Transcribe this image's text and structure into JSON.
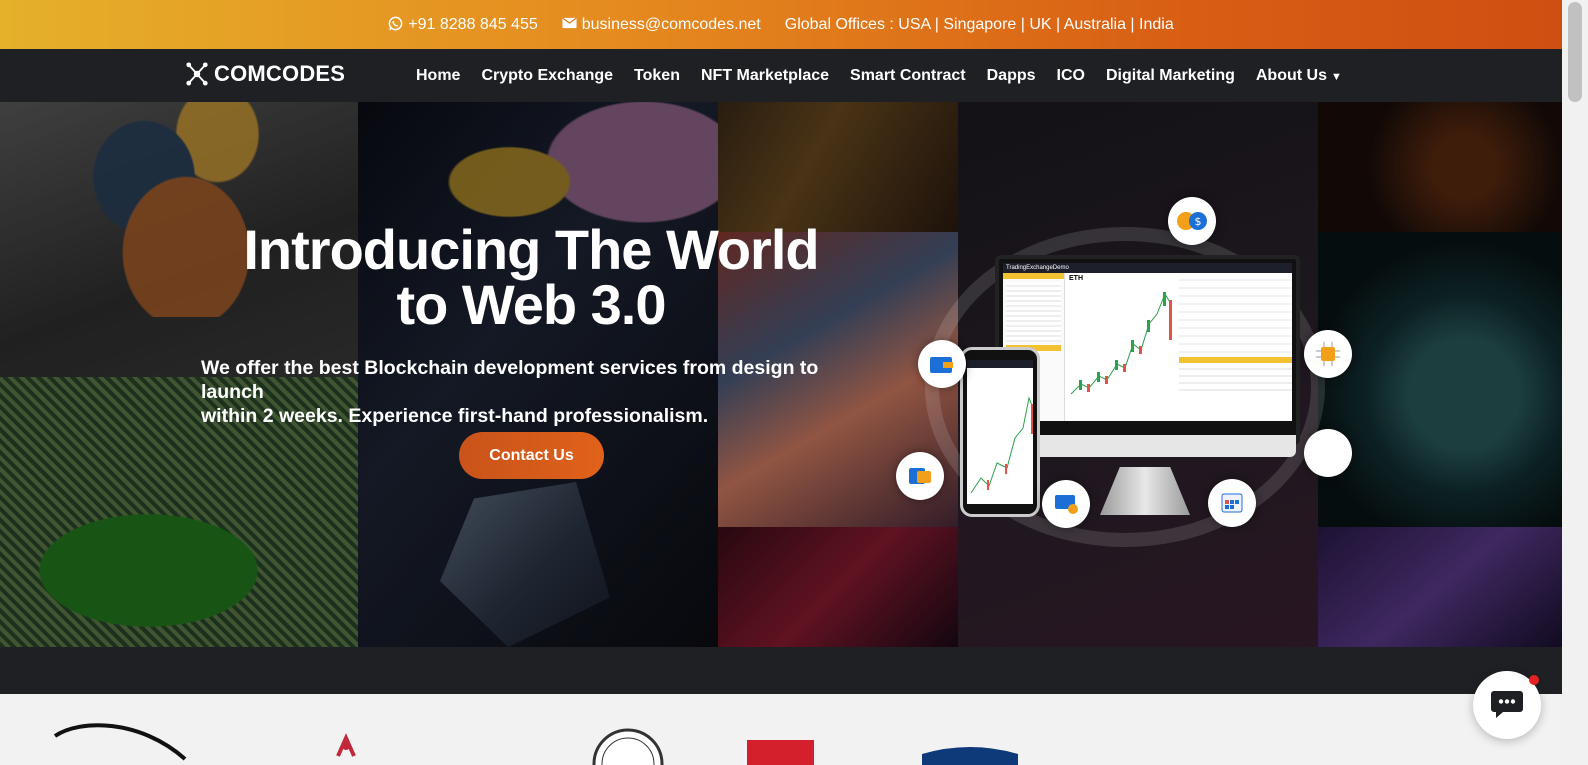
{
  "topbar": {
    "phone": "+91 8288 845 455",
    "email": "business@comcodes.net",
    "offices": "Global Offices : USA | Singapore | UK | Australia | India"
  },
  "brand": {
    "name": "COMCODES"
  },
  "nav": {
    "items": [
      {
        "label": "Home"
      },
      {
        "label": "Crypto Exchange"
      },
      {
        "label": "Token"
      },
      {
        "label": "NFT Marketplace"
      },
      {
        "label": "Smart Contract"
      },
      {
        "label": "Dapps"
      },
      {
        "label": "ICO"
      },
      {
        "label": "Digital Marketing"
      },
      {
        "label": "About Us"
      }
    ]
  },
  "hero": {
    "title_line1": "Introducing The World",
    "title_line2": "to Web 3.0",
    "subtitle_line1": "We offer the best Blockchain development services from design to launch",
    "subtitle_line2": "within 2 weeks. Experience first-hand professionalism.",
    "cta_label": "Contact Us"
  },
  "mockup": {
    "app_name": "TradingExchangeDemo",
    "pair": "ETH"
  },
  "icons": {
    "phone": "whatsapp-icon",
    "email": "envelope-icon",
    "chat": "chat-bubble-icon"
  },
  "colors": {
    "topbar_start": "#e5b02a",
    "topbar_end": "#cf4e12",
    "nav_bg": "#1e2024",
    "cta": "#d9591a"
  }
}
